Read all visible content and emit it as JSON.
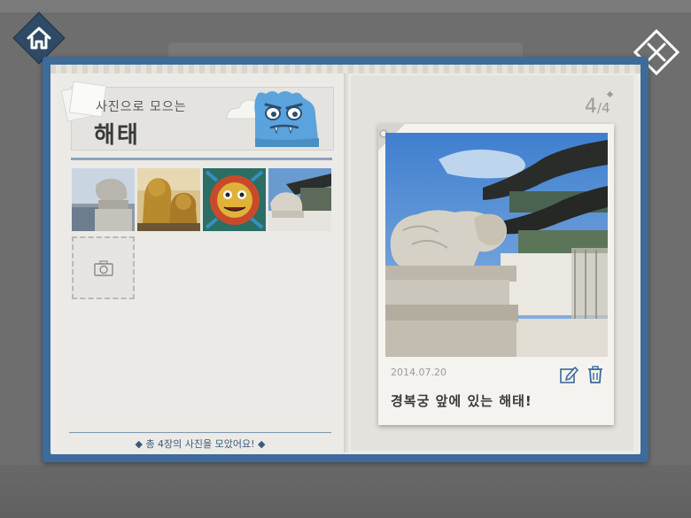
{
  "app": {
    "home_icon": "home-icon",
    "close_icon": "close-icon"
  },
  "album": {
    "subtitle": "사진으로 모으는",
    "title": "해태",
    "footer": "◆ 총 4장의 사진을 모았어요! ◆",
    "add_photo_icon": "camera-icon",
    "thumbnails": [
      {
        "label": "haetae-statue-1"
      },
      {
        "label": "golden-haetae"
      },
      {
        "label": "painted-haetae"
      },
      {
        "label": "gyeongbokgung-haetae"
      }
    ]
  },
  "detail": {
    "page_current": "4",
    "page_separator": "/",
    "page_total": "4",
    "date": "2014.07.20",
    "caption": "경복궁 앞에 있는 해태!",
    "edit_icon": "edit-icon",
    "delete_icon": "trash-icon"
  },
  "colors": {
    "frame": "#3c6b9c",
    "home_button": "#2f4a64",
    "accent_text": "#3d5a7a",
    "mascot": "#5ba3dc"
  }
}
